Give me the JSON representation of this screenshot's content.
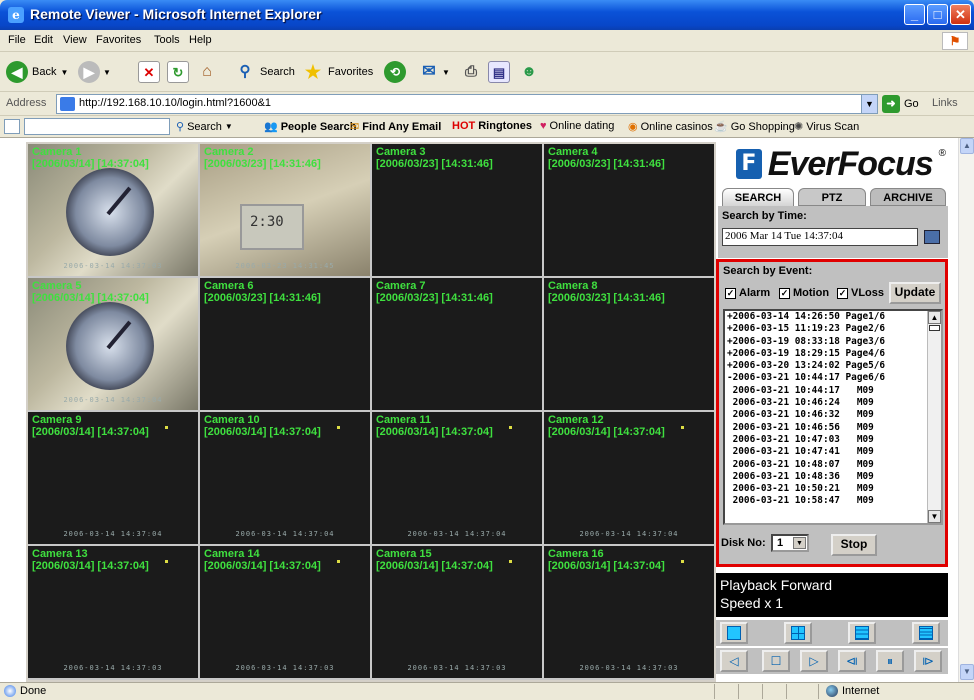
{
  "window": {
    "title": "Remote Viewer - Microsoft Internet Explorer"
  },
  "menu": [
    "File",
    "Edit",
    "View",
    "Favorites",
    "Tools",
    "Help"
  ],
  "toolbar": {
    "back": "Back",
    "search": "Search",
    "favorites": "Favorites"
  },
  "address": {
    "label": "Address",
    "url": "http://192.168.10.10/login.html?1600&1",
    "go": "Go",
    "links": "Links"
  },
  "links_bar": {
    "search": "Search",
    "people_search": "People Search",
    "find_email": "Find Any Email",
    "hot": "HOT",
    "ringtones": "Ringtones",
    "dating": "Online dating",
    "casinos": "Online casinos",
    "shopping": "Go Shopping",
    "virus": "Virus Scan"
  },
  "cameras": [
    {
      "name": "Camera 1",
      "time": "[2006/03/14] [14:37:04]",
      "stamp": "2006-03-14  14:37:03"
    },
    {
      "name": "Camera 2",
      "time": "[2006/03/23] [14:31:46]",
      "stamp": "2006-03-23  14:31:45"
    },
    {
      "name": "Camera 3",
      "time": "[2006/03/23] [14:31:46]",
      "stamp": ""
    },
    {
      "name": "Camera 4",
      "time": "[2006/03/23] [14:31:46]",
      "stamp": ""
    },
    {
      "name": "Camera 5",
      "time": "[2006/03/14] [14:37:04]",
      "stamp": "2006-03-14  14:37:04"
    },
    {
      "name": "Camera 6",
      "time": "[2006/03/23] [14:31:46]",
      "stamp": ""
    },
    {
      "name": "Camera 7",
      "time": "[2006/03/23] [14:31:46]",
      "stamp": ""
    },
    {
      "name": "Camera 8",
      "time": "[2006/03/23] [14:31:46]",
      "stamp": ""
    },
    {
      "name": "Camera 9",
      "time": "[2006/03/14] [14:37:04]",
      "stamp": "2006-03-14  14:37:04"
    },
    {
      "name": "Camera 10",
      "time": "[2006/03/14] [14:37:04]",
      "stamp": "2006-03-14  14:37:04"
    },
    {
      "name": "Camera 11",
      "time": "[2006/03/14] [14:37:04]",
      "stamp": "2006-03-14  14:37:04"
    },
    {
      "name": "Camera 12",
      "time": "[2006/03/14] [14:37:04]",
      "stamp": "2006-03-14  14:37:04"
    },
    {
      "name": "Camera 13",
      "time": "[2006/03/14] [14:37:04]",
      "stamp": "2006-03-14  14:37:03"
    },
    {
      "name": "Camera 14",
      "time": "[2006/03/14] [14:37:04]",
      "stamp": "2006-03-14  14:37:03"
    },
    {
      "name": "Camera 15",
      "time": "[2006/03/14] [14:37:04]",
      "stamp": "2006-03-14  14:37:03"
    },
    {
      "name": "Camera 16",
      "time": "[2006/03/14] [14:37:04]",
      "stamp": "2006-03-14  14:37:03"
    }
  ],
  "panel": {
    "brand": "EverFocus",
    "reg": "®",
    "tabs": [
      "SEARCH",
      "PTZ",
      "ARCHIVE"
    ],
    "search_by_time": "Search by Time:",
    "time_value": "2006 Mar 14 Tue 14:37:04",
    "search_by_event": "Search by Event:",
    "filters": [
      "Alarm",
      "Motion",
      "VLoss"
    ],
    "update": "Update",
    "events": [
      "+2006-03-14 14:26:50 Page1/6",
      "+2006-03-15 11:19:23 Page2/6",
      "+2006-03-19 08:33:18 Page3/6",
      "+2006-03-19 18:29:15 Page4/6",
      "+2006-03-20 13:24:02 Page5/6",
      "-2006-03-21 10:44:17 Page6/6",
      " 2006-03-21 10:44:17   M09",
      " 2006-03-21 10:46:24   M09",
      " 2006-03-21 10:46:32   M09",
      " 2006-03-21 10:46:56   M09",
      " 2006-03-21 10:47:03   M09",
      " 2006-03-21 10:47:41   M09",
      " 2006-03-21 10:48:07   M09",
      " 2006-03-21 10:48:36   M09",
      " 2006-03-21 10:50:21   M09",
      " 2006-03-21 10:58:47   M09"
    ],
    "disk_label": "Disk No:",
    "disk_value": "1",
    "stop": "Stop",
    "playback_line1": "Playback Forward",
    "playback_line2": "Speed x 1"
  },
  "status": {
    "left": "Done",
    "zone": "Internet"
  }
}
